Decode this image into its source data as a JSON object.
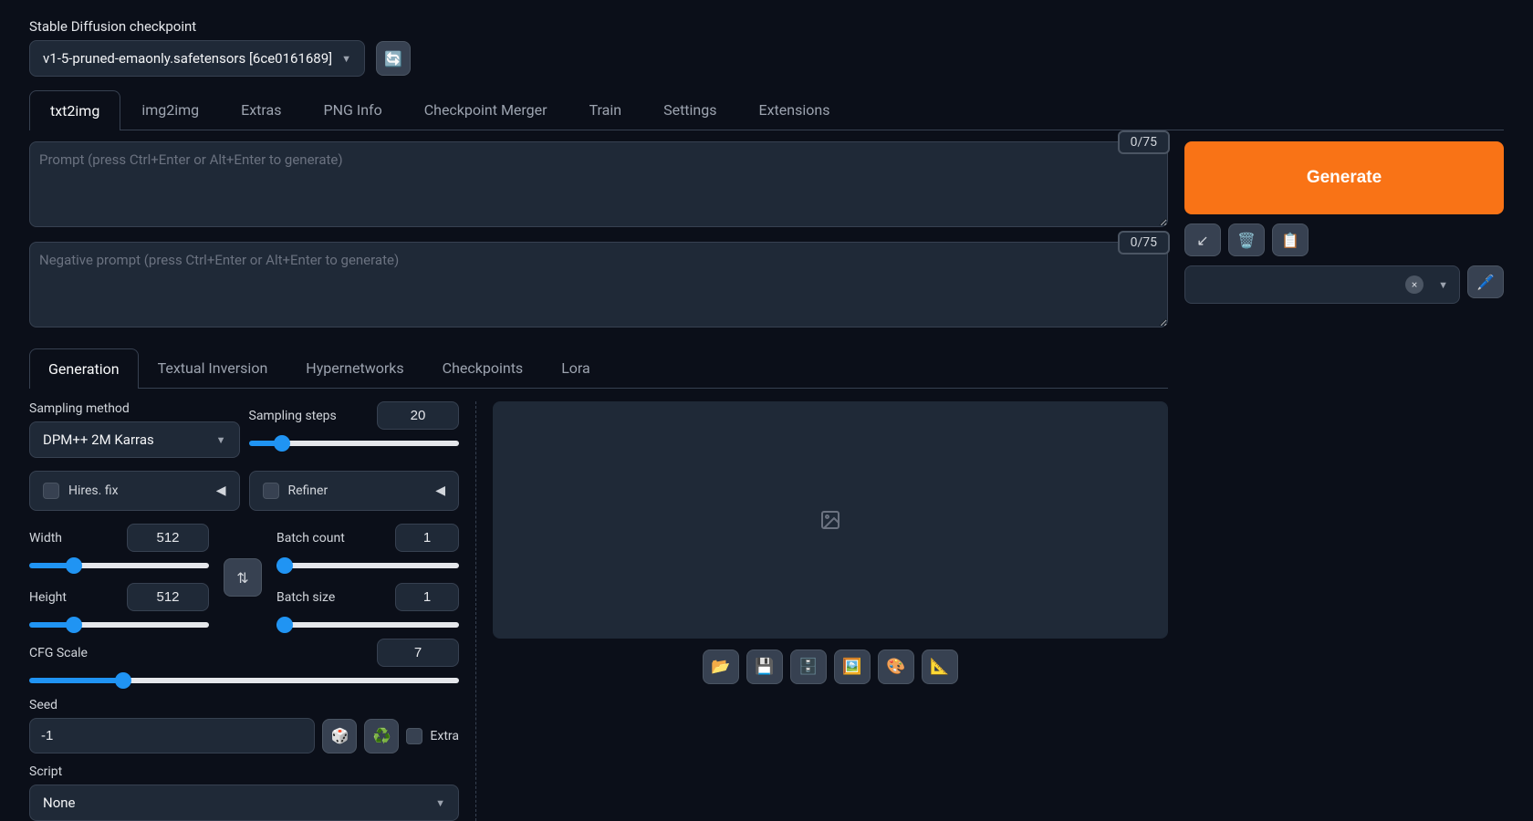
{
  "header": {
    "checkpoint_label": "Stable Diffusion checkpoint",
    "checkpoint_value": "v1-5-pruned-emaonly.safetensors [6ce0161689]"
  },
  "tabs": [
    "txt2img",
    "img2img",
    "Extras",
    "PNG Info",
    "Checkpoint Merger",
    "Train",
    "Settings",
    "Extensions"
  ],
  "active_tab": "txt2img",
  "prompt": {
    "placeholder": "Prompt (press Ctrl+Enter or Alt+Enter to generate)",
    "counter": "0/75"
  },
  "neg_prompt": {
    "placeholder": "Negative prompt (press Ctrl+Enter or Alt+Enter to generate)",
    "counter": "0/75"
  },
  "generate_label": "Generate",
  "sub_tabs": [
    "Generation",
    "Textual Inversion",
    "Hypernetworks",
    "Checkpoints",
    "Lora"
  ],
  "active_sub_tab": "Generation",
  "sampling": {
    "method_label": "Sampling method",
    "method_value": "DPM++ 2M Karras",
    "steps_label": "Sampling steps",
    "steps_value": "20"
  },
  "hires": {
    "label": "Hires. fix"
  },
  "refiner": {
    "label": "Refiner"
  },
  "dims": {
    "width_label": "Width",
    "width_value": "512",
    "height_label": "Height",
    "height_value": "512"
  },
  "batch": {
    "count_label": "Batch count",
    "count_value": "1",
    "size_label": "Batch size",
    "size_value": "1"
  },
  "cfg": {
    "label": "CFG Scale",
    "value": "7"
  },
  "seed": {
    "label": "Seed",
    "value": "-1",
    "extra_label": "Extra"
  },
  "script": {
    "label": "Script",
    "value": "None"
  }
}
